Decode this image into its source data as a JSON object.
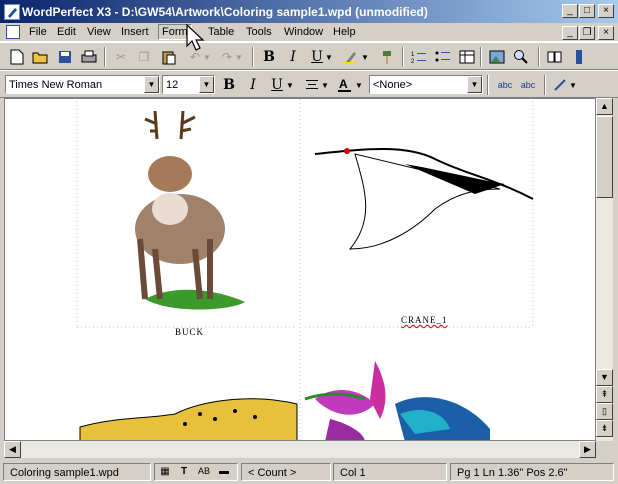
{
  "window": {
    "title": "WordPerfect X3 - D:\\GW54\\Artwork\\Coloring sample1.wpd (unmodified)",
    "minimize": "_",
    "maximize": "□",
    "close": "×",
    "doc_minimize": "_",
    "doc_restore": "❐",
    "doc_close": "×"
  },
  "menu": {
    "items": [
      "File",
      "Edit",
      "View",
      "Insert",
      "Form",
      "Table",
      "Tools",
      "Window",
      "Help"
    ]
  },
  "property_bar": {
    "font_name": "Times New Roman",
    "font_size": "12",
    "style": "<None>"
  },
  "document": {
    "images": [
      {
        "caption": "BUCK",
        "icon": "buck-clipart"
      },
      {
        "caption": "CRANE_1",
        "icon": "crane-clipart"
      },
      {
        "caption": "",
        "icon": "cheetah-clipart"
      },
      {
        "caption": "",
        "icon": "hummingbird-clipart"
      }
    ]
  },
  "status": {
    "filename": "Coloring sample1.wpd",
    "count": "< Count >",
    "column": "Col 1",
    "position": "Pg 1 Ln 1.36\" Pos 2.6\""
  }
}
